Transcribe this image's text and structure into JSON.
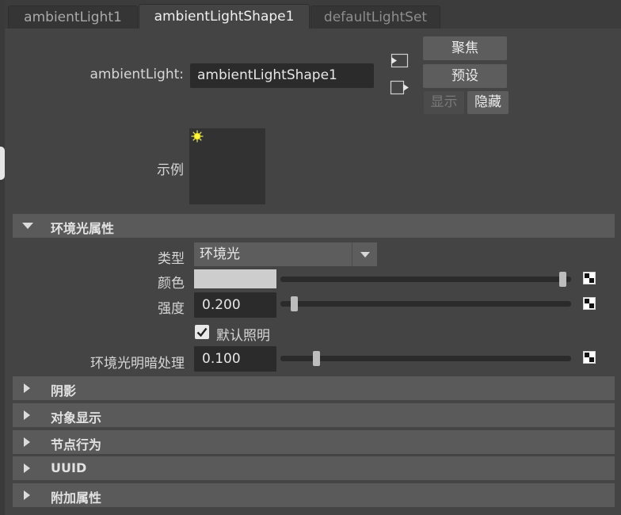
{
  "tabs": [
    {
      "label": "ambientLight1"
    },
    {
      "label": "ambientLightShape1"
    },
    {
      "label": "defaultLightSet"
    }
  ],
  "node": {
    "label": "ambientLight:",
    "value": "ambientLightShape1"
  },
  "buttons": {
    "focus": "聚焦",
    "preset": "预设",
    "show": "显示",
    "hide": "隐藏"
  },
  "swatch": {
    "label": "示例"
  },
  "section_ambient": {
    "title": "环境光属性",
    "type_label": "类型",
    "type_value": "环境光",
    "color_label": "颜色",
    "color_value": "#cdcdcd",
    "color_slider_level": 1.0,
    "intensity_label": "强度",
    "intensity_value": "0.200",
    "intensity_slider_level": 0.02,
    "default_light_label": "默认照明",
    "default_light_checked": true,
    "shade_label": "环境光明暗处理",
    "shade_value": "0.100",
    "shade_slider_level": 0.1
  },
  "sections": [
    {
      "title": "阴影"
    },
    {
      "title": "对象显示"
    },
    {
      "title": "节点行为"
    },
    {
      "title": "UUID"
    },
    {
      "title": "附加属性"
    }
  ],
  "icons": {
    "sun": "sun-icon",
    "map": "checker-map-icon",
    "input_conn": "input-connection-icon",
    "output_conn": "output-connection-icon"
  }
}
